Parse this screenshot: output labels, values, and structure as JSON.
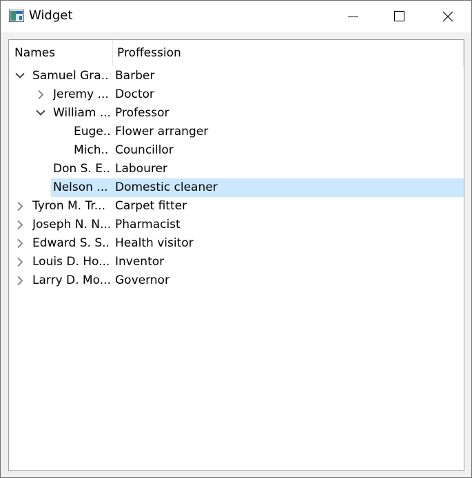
{
  "window": {
    "title": "Widget"
  },
  "tree": {
    "columns": [
      "Names",
      "Proffession"
    ],
    "rows": [
      {
        "name": "Samuel Gra...",
        "profession": "Barber",
        "level": 0,
        "expander": "expanded",
        "selected": false
      },
      {
        "name": "Jeremy ...",
        "profession": "Doctor",
        "level": 1,
        "expander": "collapsed",
        "selected": false
      },
      {
        "name": "William ...",
        "profession": "Professor",
        "level": 1,
        "expander": "expanded",
        "selected": false
      },
      {
        "name": "Euge...",
        "profession": "Flower arranger",
        "level": 2,
        "expander": "none",
        "selected": false
      },
      {
        "name": "Mich...",
        "profession": "Councillor",
        "level": 2,
        "expander": "none",
        "selected": false
      },
      {
        "name": "Don S. E...",
        "profession": "Labourer",
        "level": 1,
        "expander": "none",
        "selected": false
      },
      {
        "name": "Nelson ...",
        "profession": "Domestic cleaner",
        "level": 1,
        "expander": "none",
        "selected": true
      },
      {
        "name": "Tyron M. Tr...",
        "profession": "Carpet fitter",
        "level": 0,
        "expander": "collapsed",
        "selected": false
      },
      {
        "name": "Joseph N. N...",
        "profession": "Pharmacist",
        "level": 0,
        "expander": "collapsed",
        "selected": false
      },
      {
        "name": "Edward S. S...",
        "profession": "Health visitor",
        "level": 0,
        "expander": "collapsed",
        "selected": false
      },
      {
        "name": "Louis D. Ho...",
        "profession": "Inventor",
        "level": 0,
        "expander": "collapsed",
        "selected": false
      },
      {
        "name": "Larry D. Mo...",
        "profession": "Governor",
        "level": 0,
        "expander": "collapsed",
        "selected": false
      }
    ]
  },
  "colors": {
    "selection": "#cce8ff",
    "border": "#a0a0a0",
    "window_bg": "#f0f0f0"
  },
  "icons": [
    "app-icon",
    "minimize-icon",
    "maximize-icon",
    "close-icon",
    "chevron-down-icon",
    "chevron-right-icon"
  ]
}
